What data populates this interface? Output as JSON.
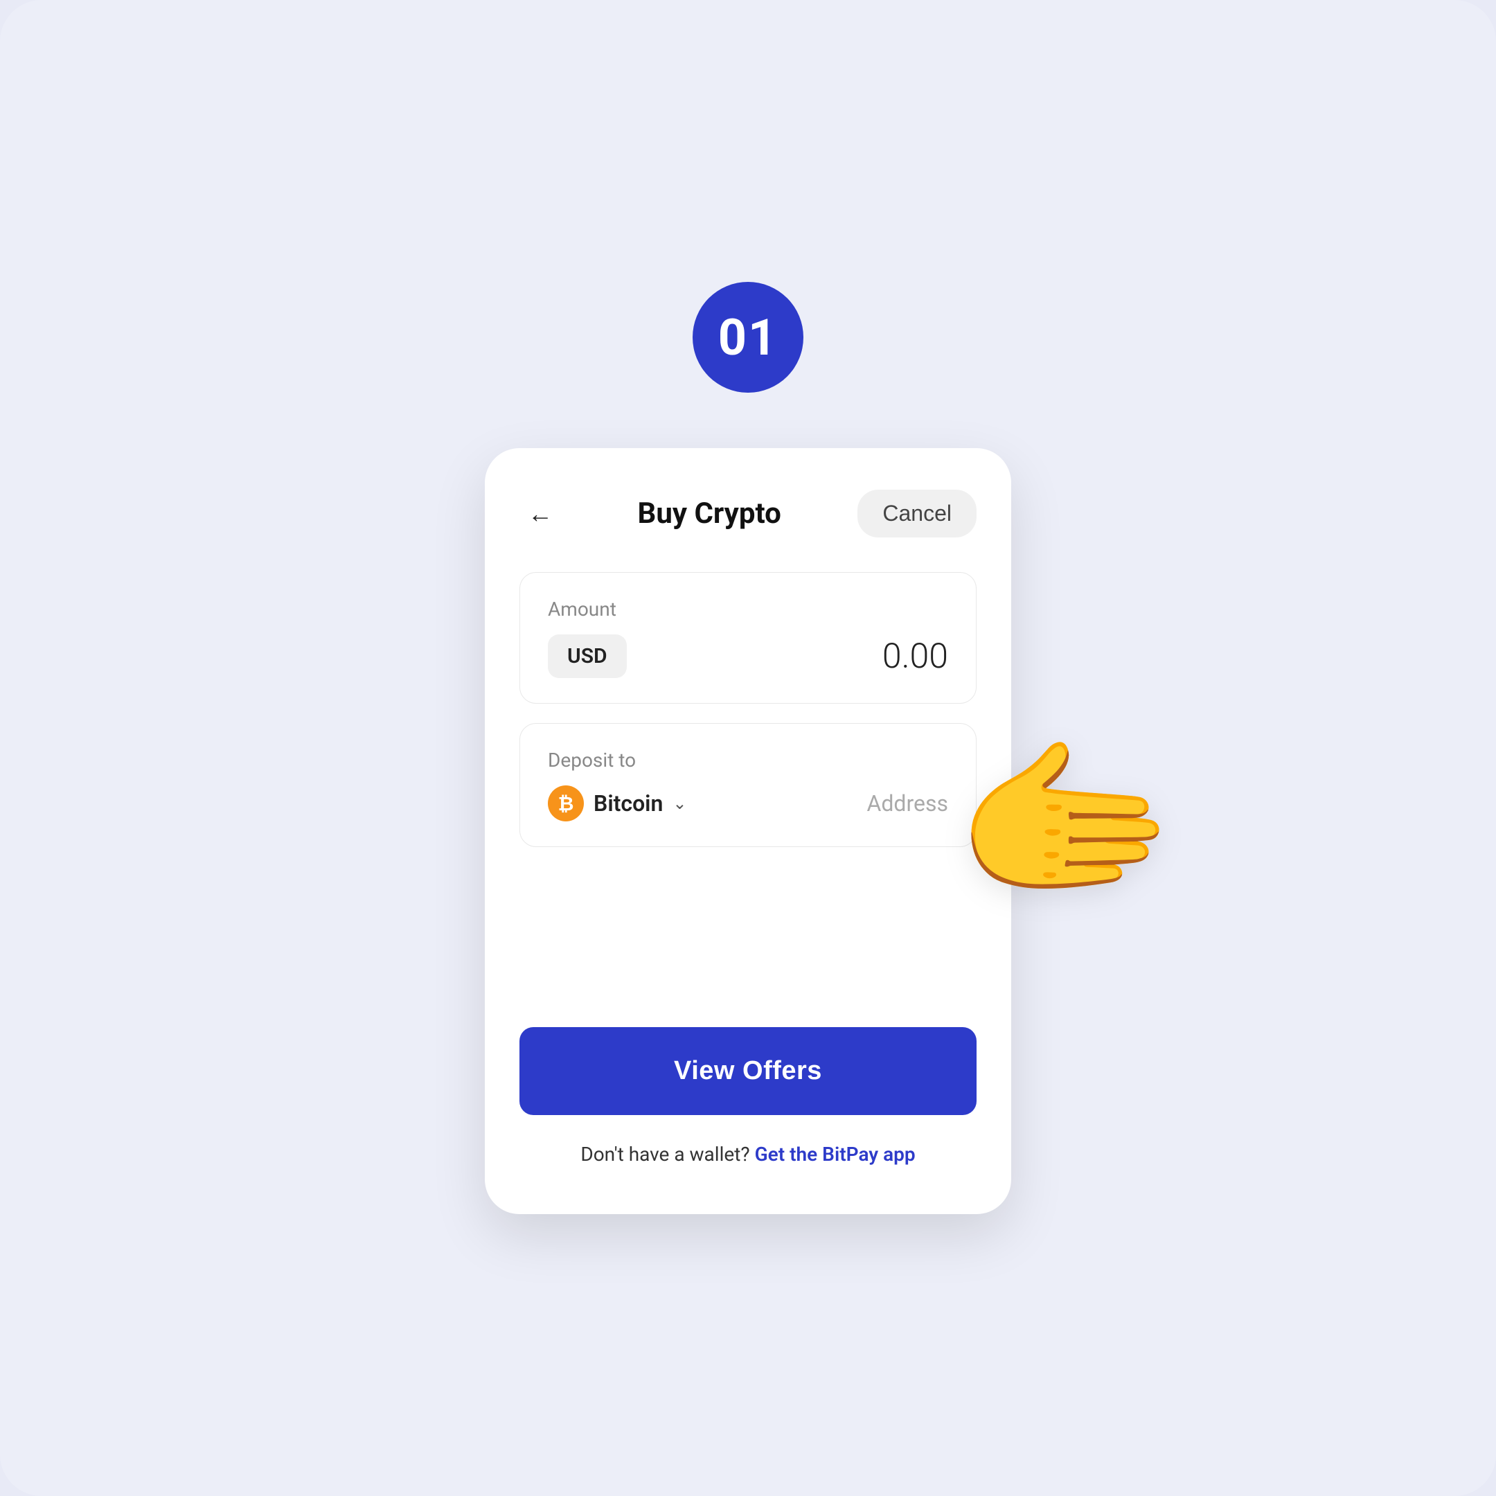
{
  "step": {
    "number": "01"
  },
  "header": {
    "title": "Buy Crypto",
    "cancel_label": "Cancel"
  },
  "amount_section": {
    "label": "Amount",
    "currency": "USD",
    "value": "0.00"
  },
  "deposit_section": {
    "label": "Deposit to",
    "coin_name": "Bitcoin",
    "address_placeholder": "Address"
  },
  "cta": {
    "view_offers_label": "View Offers"
  },
  "footer": {
    "text": "Don't have a wallet?",
    "link_text": "Get the BitPay app"
  },
  "icons": {
    "back": "←",
    "bitcoin_symbol": "₿",
    "chevron": "⌄"
  }
}
